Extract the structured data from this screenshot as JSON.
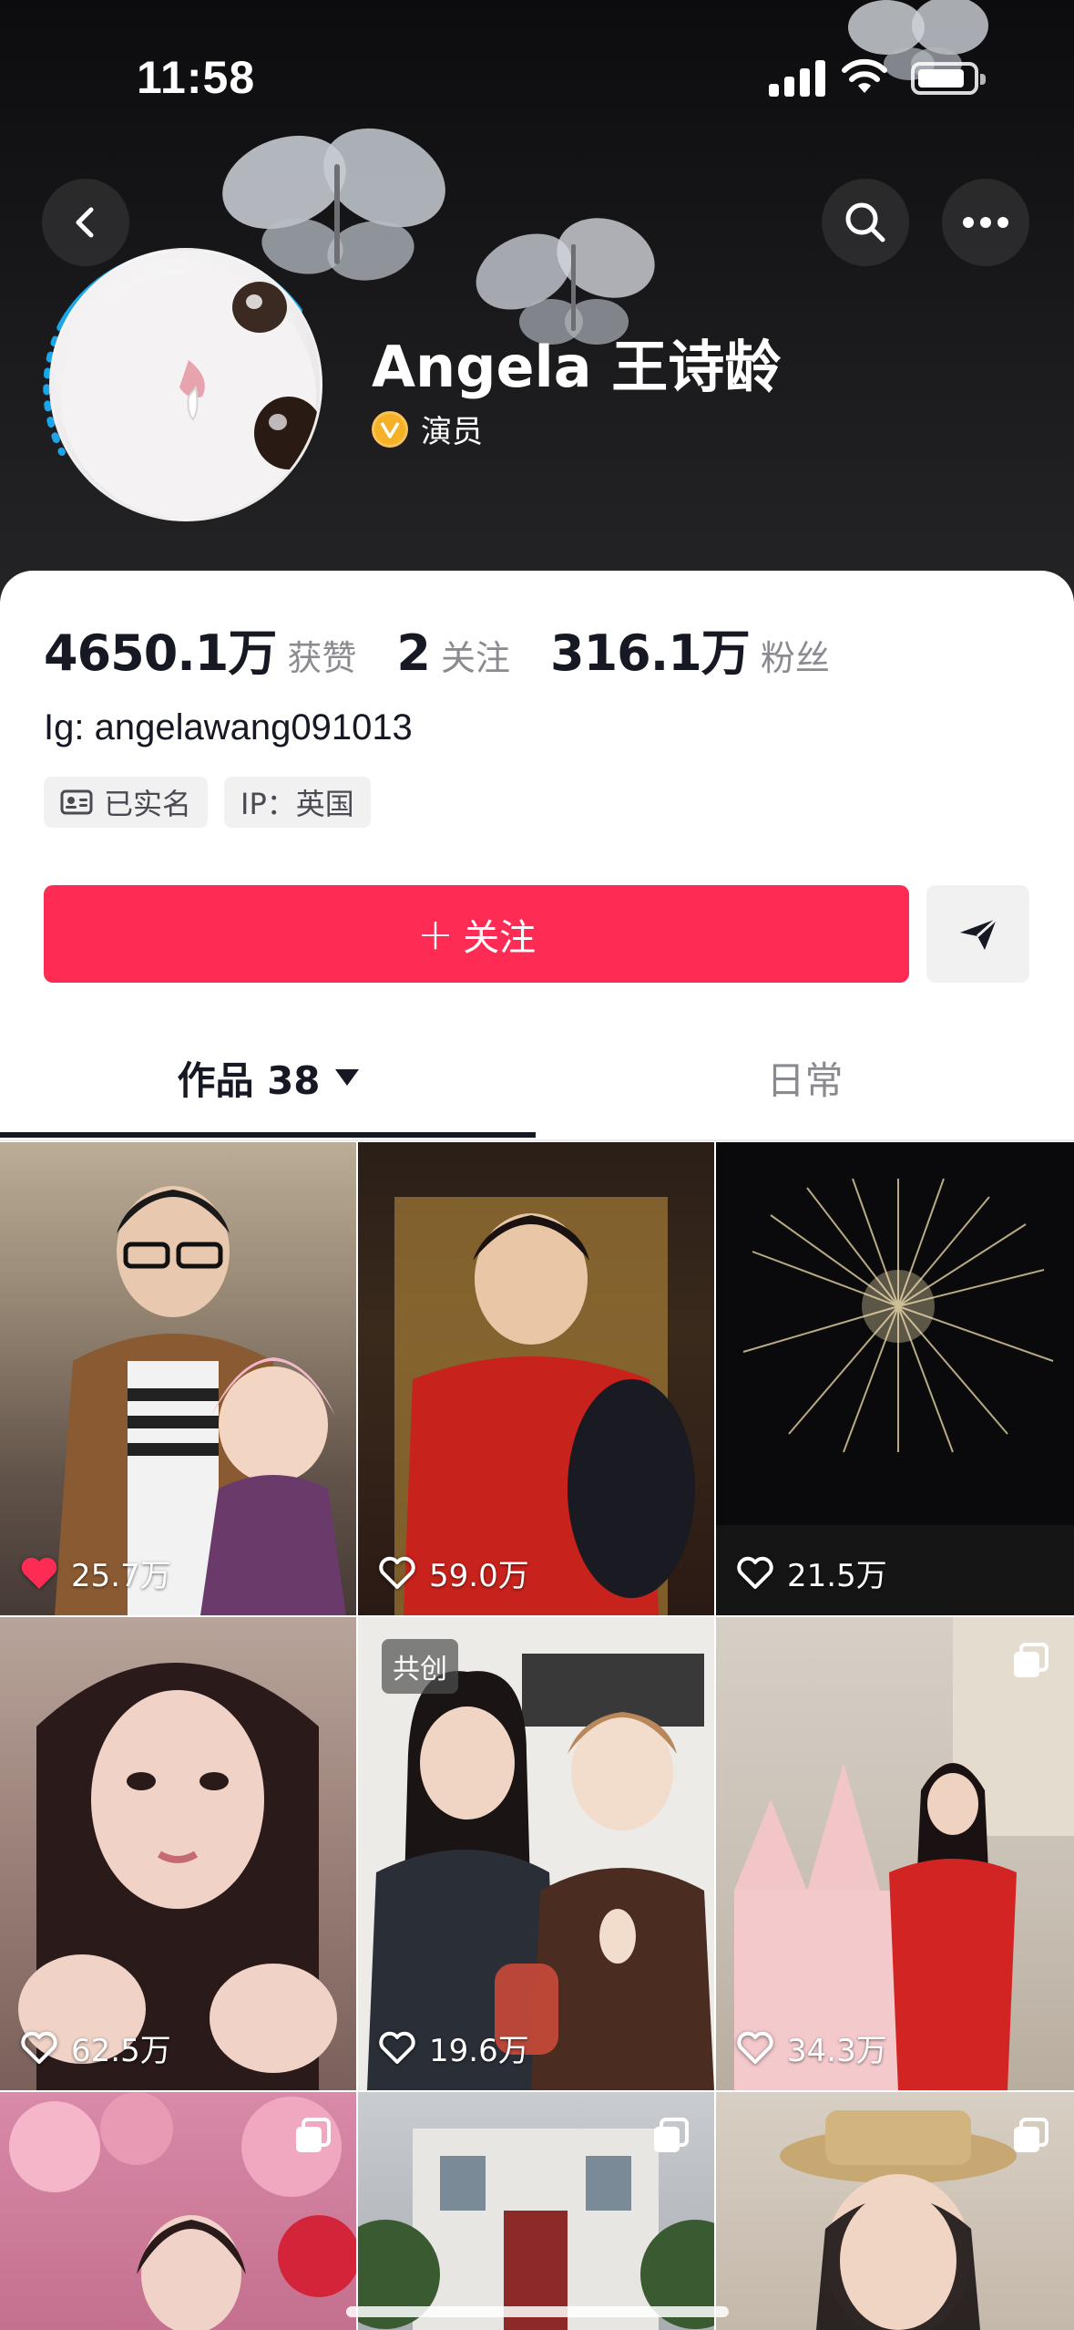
{
  "status_bar": {
    "time": "11:58"
  },
  "profile": {
    "name": "Angela 王诗龄",
    "verification": "演员",
    "stats": {
      "likes_value": "4650.1万",
      "likes_label": "获赞",
      "following_value": "2",
      "following_label": "关注",
      "followers_value": "316.1万",
      "followers_label": "粉丝"
    },
    "bio": "Ig: angelawang091013",
    "tags": {
      "verified": "已实名",
      "ip": "IP：英国"
    },
    "follow_label": "关注",
    "follow_plus": "+"
  },
  "tabs": {
    "works_label": "作品 38",
    "daily_label": "日常"
  },
  "videos": [
    {
      "likes": "25.7万",
      "liked": true
    },
    {
      "likes": "59.0万",
      "liked": false
    },
    {
      "likes": "21.5万",
      "liked": false
    },
    {
      "likes": "62.5万",
      "liked": false
    },
    {
      "likes": "19.6万",
      "liked": false,
      "badge": "共创"
    },
    {
      "likes": "34.3万",
      "liked": false
    },
    {
      "likes": "",
      "liked": false
    },
    {
      "likes": "",
      "liked": false
    },
    {
      "likes": "",
      "liked": false
    }
  ],
  "colors": {
    "accent": "#fe2c55",
    "verify": "#f6b227",
    "header_bg": "#121214"
  },
  "icons": {
    "back": "chevron-left-icon",
    "search": "search-icon",
    "more": "more-icon",
    "share": "send-icon",
    "heart": "heart-icon",
    "multi": "multi-image-icon"
  }
}
